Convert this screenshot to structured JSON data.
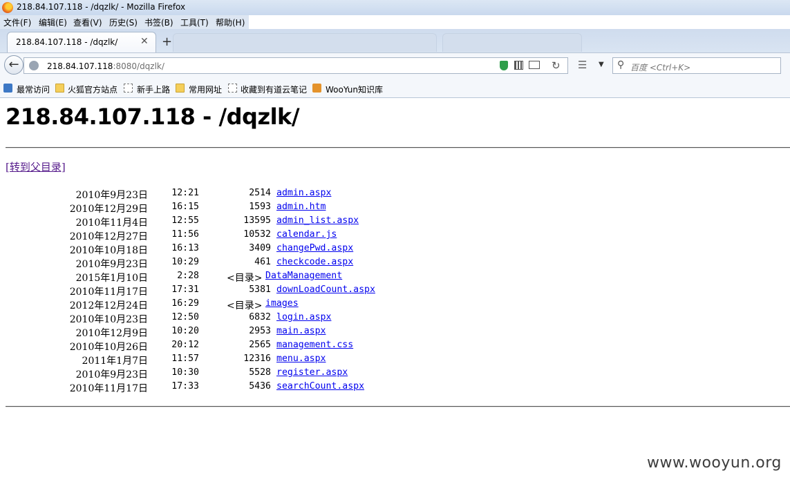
{
  "window": {
    "title": "218.84.107.118 - /dqzlk/ - Mozilla Firefox"
  },
  "menu": [
    "文件(F)",
    "编辑(E)",
    "查看(V)",
    "历史(S)",
    "书签(B)",
    "工具(T)",
    "帮助(H)"
  ],
  "tab": {
    "title": "218.84.107.118 - /dqzlk/",
    "close": "✕",
    "new_tab": "+"
  },
  "nav": {
    "url_host": "218.84.107.118",
    "url_rest": ":8080/dqzlk/",
    "search_placeholder": "百度 <Ctrl+K>"
  },
  "bookmarks": [
    "最常访问",
    "火狐官方站点",
    "新手上路",
    "常用网址",
    "收藏到有道云笔记",
    "WooYun知识库"
  ],
  "page": {
    "heading": "218.84.107.118 - /dqzlk/",
    "parent_link": "[转到父目录]",
    "dir_label": "<目录>",
    "entries": [
      {
        "date": "2010年9月23日",
        "time": "12:21",
        "size": "2514",
        "name": "admin.aspx"
      },
      {
        "date": "2010年12月29日",
        "time": "16:15",
        "size": "1593",
        "name": "admin.htm"
      },
      {
        "date": "2010年11月4日",
        "time": "12:55",
        "size": "13595",
        "name": "admin_list.aspx"
      },
      {
        "date": "2010年12月27日",
        "time": "11:56",
        "size": "10532",
        "name": "calendar.js"
      },
      {
        "date": "2010年10月18日",
        "time": "16:13",
        "size": "3409",
        "name": "changePwd.aspx"
      },
      {
        "date": "2010年9月23日",
        "time": "10:29",
        "size": "461",
        "name": "checkcode.aspx"
      },
      {
        "date": "2015年1月10日",
        "time": "2:28",
        "size": "<目录>",
        "name": "DataManagement"
      },
      {
        "date": "2010年11月17日",
        "time": "17:31",
        "size": "5381",
        "name": "downLoadCount.aspx"
      },
      {
        "date": "2012年12月24日",
        "time": "16:29",
        "size": "<目录>",
        "name": "images"
      },
      {
        "date": "2010年10月23日",
        "time": "12:50",
        "size": "6832",
        "name": "login.aspx"
      },
      {
        "date": "2010年12月9日",
        "time": "10:20",
        "size": "2953",
        "name": "main.aspx"
      },
      {
        "date": "2010年10月26日",
        "time": "20:12",
        "size": "2565",
        "name": "management.css"
      },
      {
        "date": "2011年1月7日",
        "time": "11:57",
        "size": "12316",
        "name": "menu.aspx"
      },
      {
        "date": "2010年9月23日",
        "time": "10:30",
        "size": "5528",
        "name": "register.aspx"
      },
      {
        "date": "2010年11月17日",
        "time": "17:33",
        "size": "5436",
        "name": "searchCount.aspx"
      }
    ]
  },
  "watermark": "www.wooyun.org"
}
